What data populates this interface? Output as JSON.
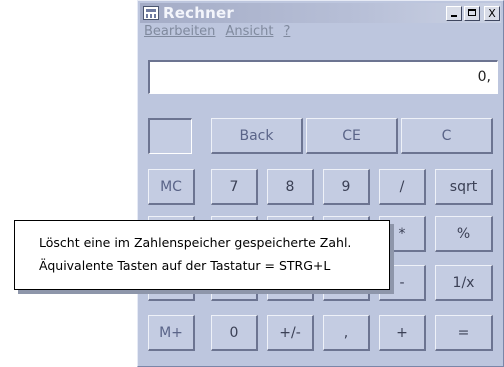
{
  "window": {
    "title": "Rechner",
    "controls": {
      "minimize": "_",
      "maximize": "□",
      "close": "X"
    }
  },
  "menu": {
    "items": [
      "Bearbeiten",
      "Ansicht",
      "?"
    ]
  },
  "display": {
    "value": "0,"
  },
  "buttons": {
    "row1": [
      "Back",
      "CE",
      "C"
    ],
    "row2": [
      "MC",
      "7",
      "8",
      "9",
      "/",
      "sqrt"
    ],
    "row3_partial": [
      "*",
      "%"
    ],
    "row4_partial": [
      "-",
      "1/x"
    ],
    "row5": [
      "M+",
      "0",
      "+/-",
      ",",
      "+",
      "="
    ]
  },
  "tooltip": {
    "line1": "Löscht eine im Zahlenspeicher gespeicherte Zahl.",
    "line2": "Äquivalente Tasten auf der Tastatur = STRG+L"
  }
}
